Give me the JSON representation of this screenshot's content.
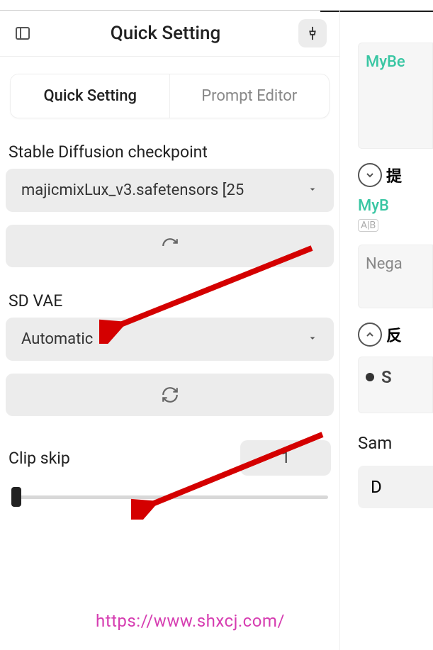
{
  "header": {
    "title": "Quick Setting"
  },
  "tabs": {
    "items": [
      {
        "label": "Quick Setting",
        "active": true
      },
      {
        "label": "Prompt Editor",
        "active": false
      }
    ]
  },
  "checkpoint": {
    "label": "Stable Diffusion checkpoint",
    "value": "majicmixLux_v3.safetensors [25"
  },
  "vae": {
    "label": "SD VAE",
    "value": "Automatic"
  },
  "clip_skip": {
    "label": "Clip skip",
    "value": "1"
  },
  "right": {
    "mybe_top": "MyBe",
    "prompt_header": "提",
    "myb": "MyB",
    "negative": "Nega",
    "neg_header": "反",
    "s_label": "S",
    "sam_label": "Sam",
    "d_label": "D"
  },
  "watermark": "https://www.shxcj.com/"
}
